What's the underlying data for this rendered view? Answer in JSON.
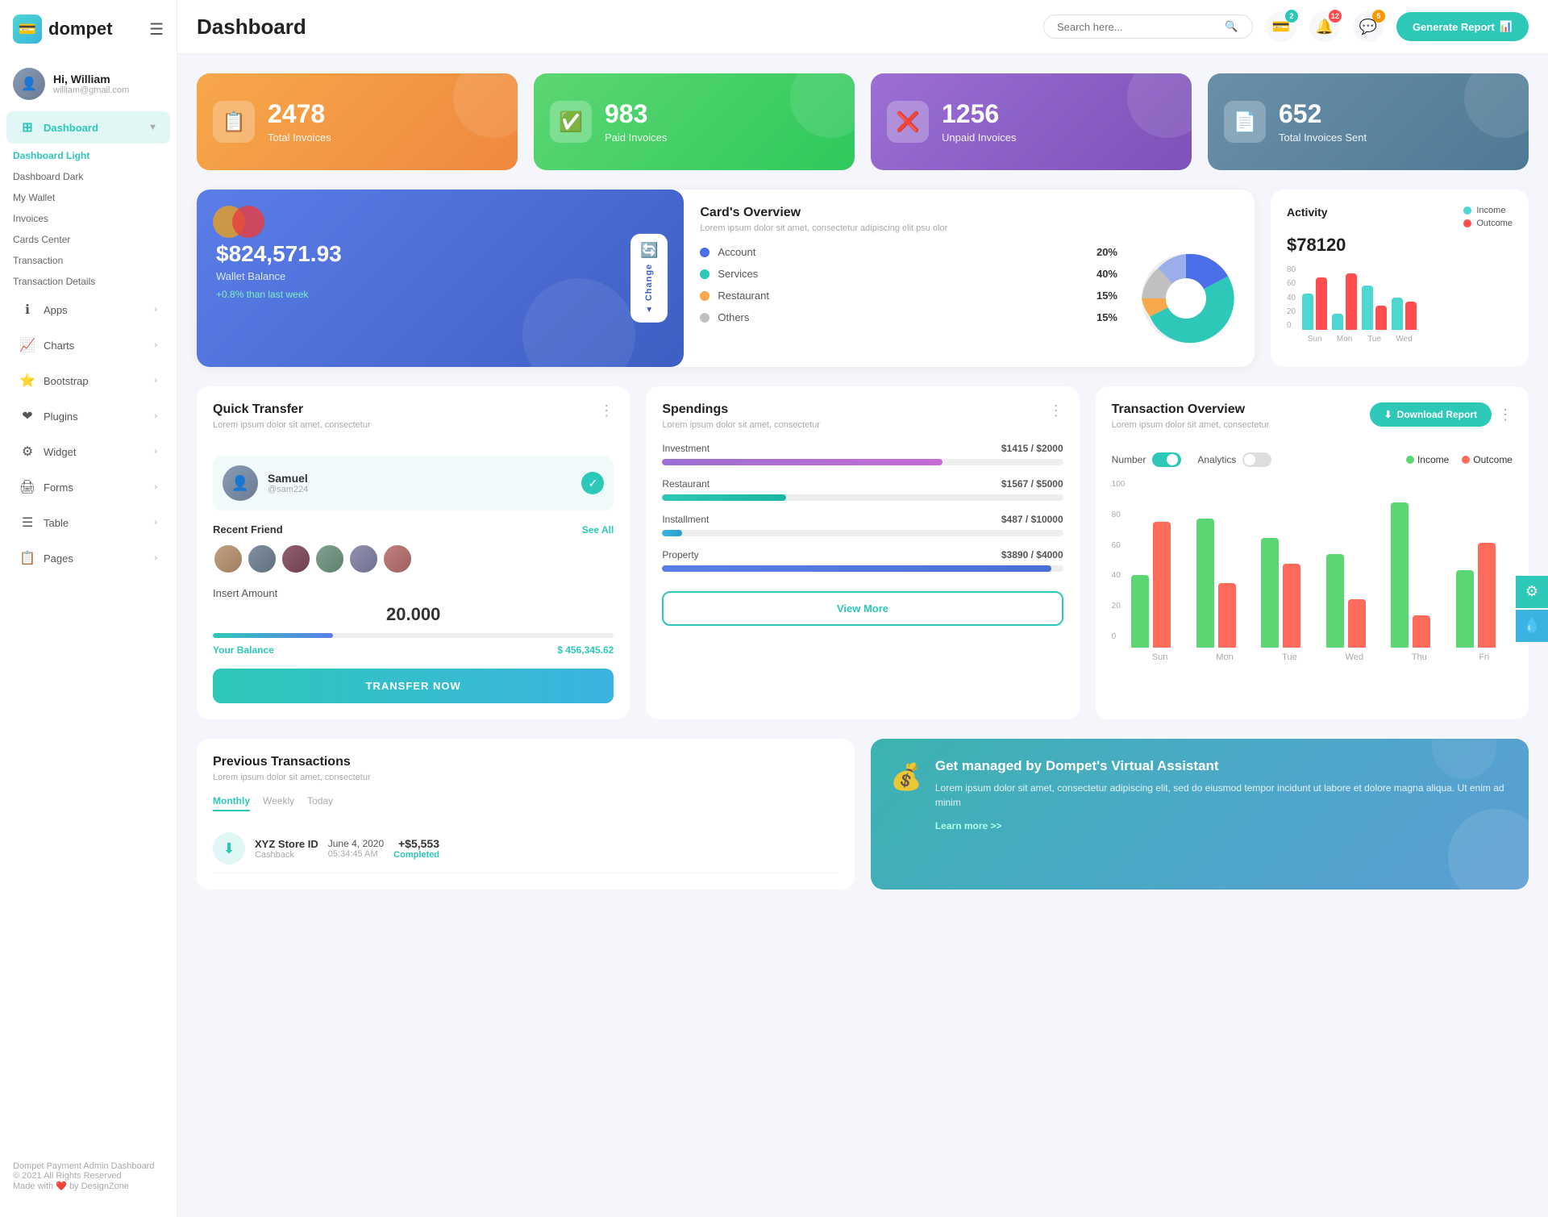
{
  "app": {
    "name": "dompet",
    "logo_char": "💳"
  },
  "header": {
    "title": "Dashboard",
    "search_placeholder": "Search here...",
    "generate_btn": "Generate Report",
    "icons": {
      "wallet_badge": "2",
      "bell_badge": "12",
      "chat_badge": "5"
    }
  },
  "user": {
    "greeting": "Hi, William",
    "email": "william@gmail.com",
    "avatar_char": "👤"
  },
  "sidebar": {
    "dashboard_label": "Dashboard",
    "sub_items": [
      {
        "label": "Dashboard Light",
        "active": true
      },
      {
        "label": "Dashboard Dark",
        "active": false
      },
      {
        "label": "My Wallet",
        "active": false
      },
      {
        "label": "Invoices",
        "active": false
      },
      {
        "label": "Cards Center",
        "active": false
      },
      {
        "label": "Transaction",
        "active": false
      },
      {
        "label": "Transaction Details",
        "active": false
      }
    ],
    "nav_items": [
      {
        "label": "Apps",
        "icon": "ℹ️"
      },
      {
        "label": "Charts",
        "icon": "📊"
      },
      {
        "label": "Bootstrap",
        "icon": "⭐"
      },
      {
        "label": "Plugins",
        "icon": "❤️"
      },
      {
        "label": "Widget",
        "icon": "⚙️"
      },
      {
        "label": "Forms",
        "icon": "🖨️"
      },
      {
        "label": "Table",
        "icon": "☰"
      },
      {
        "label": "Pages",
        "icon": "📋"
      }
    ],
    "footer_line1": "Dompet Payment Admin Dashboard",
    "footer_line2": "© 2021 All Rights Reserved",
    "footer_line3": "Made with ❤️ by DesignZone"
  },
  "stats": [
    {
      "number": "2478",
      "label": "Total Invoices",
      "color": "orange",
      "icon": "📋"
    },
    {
      "number": "983",
      "label": "Paid Invoices",
      "color": "green",
      "icon": "✅"
    },
    {
      "number": "1256",
      "label": "Unpaid Invoices",
      "color": "purple",
      "icon": "❌"
    },
    {
      "number": "652",
      "label": "Total Invoices Sent",
      "color": "slate",
      "icon": "📄"
    }
  ],
  "wallet": {
    "amount": "$824,571.93",
    "label": "Wallet Balance",
    "change": "+0.8% than last week",
    "change_btn": "Change"
  },
  "cards_overview": {
    "title": "Card's Overview",
    "subtitle": "Lorem ipsum dolor sit amet, consectetur adipiscing elit psu olor",
    "items": [
      {
        "label": "Account",
        "percent": "20%",
        "color": "blue"
      },
      {
        "label": "Services",
        "percent": "40%",
        "color": "green"
      },
      {
        "label": "Restaurant",
        "percent": "15%",
        "color": "orange"
      },
      {
        "label": "Others",
        "percent": "15%",
        "color": "gray"
      }
    ]
  },
  "activity": {
    "title": "Activity",
    "amount": "$78120",
    "income_label": "Income",
    "outcome_label": "Outcome",
    "bars": [
      {
        "day": "Sun",
        "income": 45,
        "outcome": 65
      },
      {
        "day": "Mon",
        "income": 20,
        "outcome": 70
      },
      {
        "day": "Tue",
        "income": 55,
        "outcome": 30
      },
      {
        "day": "Wed",
        "income": 40,
        "outcome": 35
      }
    ]
  },
  "quick_transfer": {
    "title": "Quick Transfer",
    "subtitle": "Lorem ipsum dolor sit amet, consectetur",
    "user_name": "Samuel",
    "user_handle": "@sam224",
    "recent_friend_label": "Recent Friend",
    "see_all_label": "See All",
    "amount_label": "Insert Amount",
    "amount_value": "20.000",
    "balance_label": "Your Balance",
    "balance_value": "$ 456,345.62",
    "progress": 30,
    "btn_label": "TRANSFER NOW",
    "friends": 6
  },
  "spendings": {
    "title": "Spendings",
    "subtitle": "Lorem ipsum dolor sit amet, consectetur",
    "items": [
      {
        "label": "Investment",
        "amount": "$1415",
        "max": "$2000",
        "fill_pct": 70,
        "color": "purple"
      },
      {
        "label": "Restaurant",
        "amount": "$1567",
        "max": "$5000",
        "fill_pct": 30,
        "color": "teal"
      },
      {
        "label": "Installment",
        "amount": "$487",
        "max": "$10000",
        "fill_pct": 5,
        "color": "cyan"
      },
      {
        "label": "Property",
        "amount": "$3890",
        "max": "$4000",
        "fill_pct": 97,
        "color": "blue-dark"
      }
    ],
    "view_more_btn": "View More"
  },
  "transaction_overview": {
    "title": "Transaction Overview",
    "subtitle": "Lorem ipsum dolor sit amet, consectetur",
    "download_btn": "Download Report",
    "toggle_number": "Number",
    "toggle_analytics": "Analytics",
    "income_label": "Income",
    "outcome_label": "Outcome",
    "y_labels": [
      "0",
      "20",
      "40",
      "60",
      "80",
      "100"
    ],
    "bars": [
      {
        "day": "Sun",
        "income": 45,
        "outcome": 78
      },
      {
        "day": "Mon",
        "income": 80,
        "outcome": 40
      },
      {
        "day": "Tue",
        "income": 68,
        "outcome": 52
      },
      {
        "day": "Wed",
        "income": 58,
        "outcome": 30
      },
      {
        "day": "Thu",
        "income": 90,
        "outcome": 20
      },
      {
        "day": "Fri",
        "income": 48,
        "outcome": 65
      }
    ]
  },
  "prev_transactions": {
    "title": "Previous Transactions",
    "subtitle": "Lorem ipsum dolor sit amet, consectetur",
    "tabs": [
      "Monthly",
      "Weekly",
      "Today"
    ],
    "active_tab": 0,
    "items": [
      {
        "name": "XYZ Store ID",
        "type": "Cashback",
        "date": "June 4, 2020",
        "time": "05:34:45 AM",
        "amount": "+$5,553",
        "status": "Completed",
        "icon": "⬇️",
        "icon_color": "teal"
      }
    ]
  },
  "banner": {
    "title": "Get managed by Dompet's Virtual Assistant",
    "text": "Lorem ipsum dolor sit amet, consectetur adipiscing elit, sed do eiusmod tempor incidunt ut labore et dolore magna aliqua. Ut enim ad minim",
    "link": "Learn more >>",
    "icon": "💰"
  }
}
